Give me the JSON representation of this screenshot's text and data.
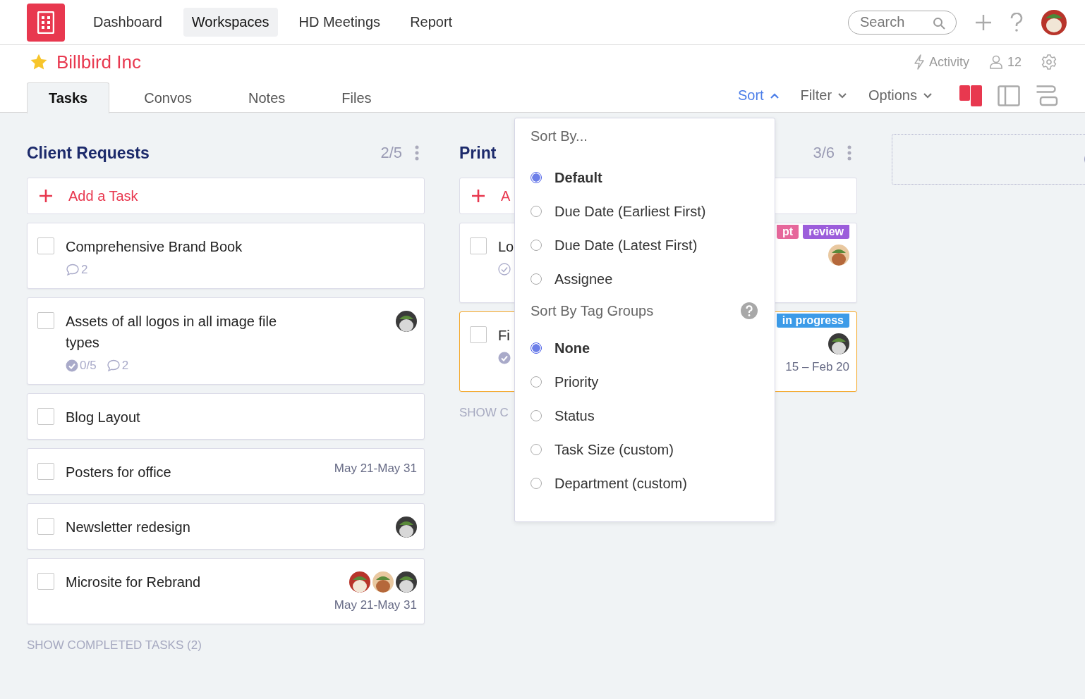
{
  "nav": [
    {
      "label": "Dashboard",
      "selected": false
    },
    {
      "label": "Workspaces",
      "selected": true
    },
    {
      "label": "HD Meetings",
      "selected": false
    },
    {
      "label": "Report",
      "selected": false
    }
  ],
  "search": {
    "placeholder": "Search"
  },
  "project": {
    "title": "Billbird Inc",
    "starred": true
  },
  "header_actions": {
    "activity": "Activity",
    "members": "12"
  },
  "tabs": [
    {
      "label": "Tasks",
      "selected": true
    },
    {
      "label": "Convos",
      "selected": false
    },
    {
      "label": "Notes",
      "selected": false
    },
    {
      "label": "Files",
      "selected": false
    }
  ],
  "toolbar": [
    {
      "label": "Sort",
      "expanded": true
    },
    {
      "label": "Filter",
      "expanded": false
    },
    {
      "label": "Options",
      "expanded": false
    }
  ],
  "views": [
    {
      "kind": "board",
      "selected": true
    },
    {
      "kind": "split",
      "selected": false
    },
    {
      "kind": "list",
      "selected": false
    }
  ],
  "columns": [
    {
      "title": "Client Requests",
      "count": "2/5",
      "add_label": "Add a Task",
      "show_completed": "SHOW COMPLETED TASKS (2)",
      "cards": [
        {
          "title": "Comprehensive Brand Book",
          "checked": false,
          "highlighted": false,
          "comments": "2"
        },
        {
          "title": "Assets of all logos in all image file types",
          "checked": false,
          "highlighted": false,
          "subtasks": "0/5",
          "comments": "2",
          "avatars": [
            {
              "kind": "picture"
            }
          ]
        },
        {
          "title": "Blog Layout",
          "checked": false,
          "highlighted": false
        },
        {
          "title": "Posters for office",
          "checked": false,
          "highlighted": false,
          "date": "May 21-May 31"
        },
        {
          "title": "Newsletter redesign",
          "checked": false,
          "highlighted": false,
          "avatars": [
            {
              "kind": "picture"
            }
          ]
        },
        {
          "title": "Microsite for Rebrand",
          "checked": false,
          "highlighted": false,
          "avatars": [
            {
              "kind": "picture"
            },
            {
              "kind": "picture"
            },
            {
              "kind": "picture"
            }
          ],
          "date": "May 21-May 31"
        }
      ]
    },
    {
      "title": "Print",
      "count": "3/6",
      "add_label": "A",
      "show_completed": "SHOW C",
      "cards": [
        {
          "title": "Lo",
          "checked": false,
          "highlighted": false,
          "checklist_done": false,
          "tags": [
            {
              "label": "pt",
              "color": "#e6679b"
            },
            {
              "label": "review",
              "color": "#9c5ddb"
            }
          ],
          "avatars": [
            {
              "kind": "picture"
            }
          ]
        },
        {
          "title": "Fi",
          "checked": false,
          "highlighted": true,
          "checklist_done": true,
          "tags": [
            {
              "label": "in progress",
              "color": "#3c9be8"
            }
          ],
          "avatars": [
            {
              "kind": "picture"
            }
          ],
          "date": "15 – Feb 20"
        }
      ]
    }
  ],
  "sort_menu": {
    "heading": "Sort By...",
    "options": [
      {
        "label": "Default",
        "selected": true
      },
      {
        "label": "Due Date (Earliest First)",
        "selected": false
      },
      {
        "label": "Due Date (Latest First)",
        "selected": false
      },
      {
        "label": "Assignee",
        "selected": false
      }
    ],
    "group_heading": "Sort By Tag Groups",
    "group_options": [
      {
        "label": "None",
        "selected": true
      },
      {
        "label": "Priority",
        "selected": false
      },
      {
        "label": "Status",
        "selected": false
      },
      {
        "label": "Task Size (custom)",
        "selected": false
      },
      {
        "label": "Department (custom)",
        "selected": false
      }
    ]
  }
}
